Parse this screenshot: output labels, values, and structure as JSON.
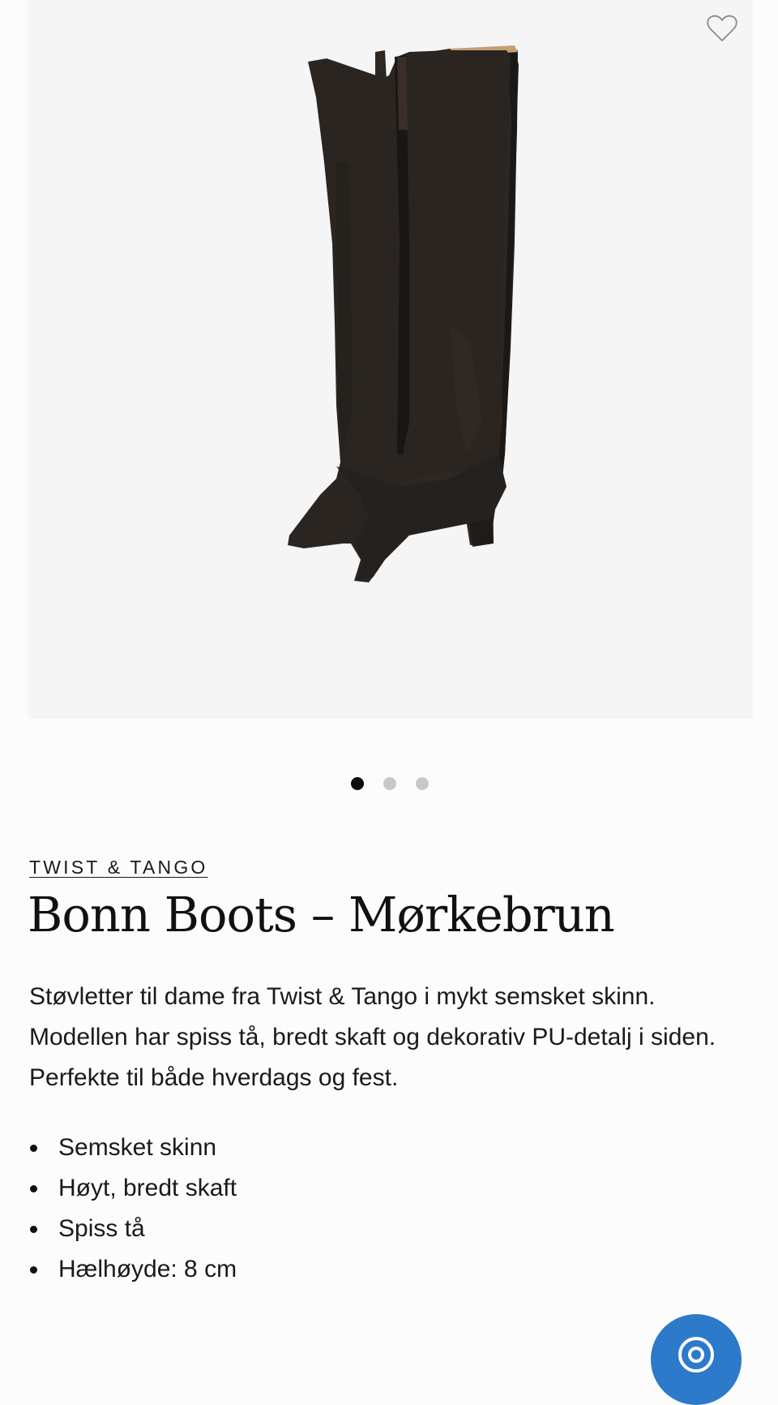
{
  "product": {
    "brand": "TWIST & TANGO",
    "title": "Bonn Boots – Mørkebrun",
    "description": "Støvletter til dame fra Twist & Tango i mykt semsket skinn. Modellen har spiss tå, bredt skaft og dekorativ PU-detalj i siden. Perfekte til både hverdags og fest.",
    "features": [
      "Semsket skinn",
      "Høyt, bredt skaft",
      "Spiss tå",
      "Hælhøyde: 8 cm"
    ]
  },
  "gallery": {
    "image_count": 3,
    "active_index": 0,
    "background_color": "#f5f5f5",
    "wishlist_icon": "heart-outline-icon"
  },
  "chat": {
    "icon": "chat-bubble-icon",
    "color": "#2c7ac9"
  }
}
